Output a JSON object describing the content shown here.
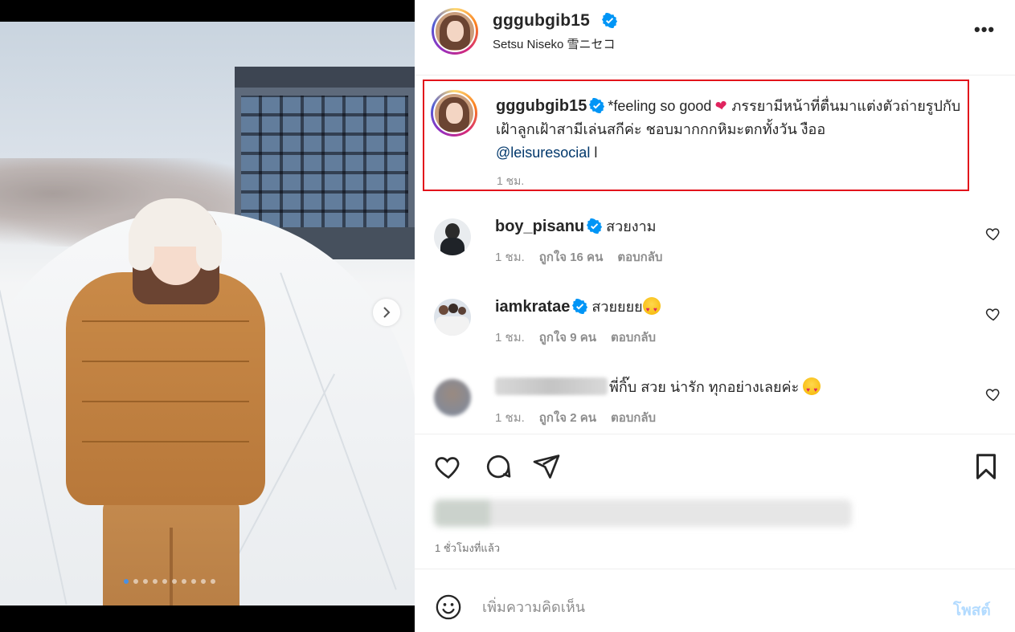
{
  "post": {
    "username": "gggubgib15",
    "location": "Setsu Niseko 雪ニセコ",
    "more_label": "•••"
  },
  "caption": {
    "username": "gggubgib15",
    "text_start": "*feeling so good ",
    "text_rest": " ภรรยามีหน้าที่ตื่นมาแต่งตัวถ่ายรูปกับเฝ้าลูกเฝ้าสามีเล่นสกีค่ะ ชอบมากกกหิมะตกทั้งวัน งืออ",
    "mention": "@leisuresocial",
    "text_end": " l",
    "time": "1 ชม."
  },
  "comments": [
    {
      "username": "boy_pisanu",
      "text": "สวยงาม",
      "time": "1 ชม.",
      "likes": "ถูกใจ 16 คน",
      "reply": "ตอบกลับ"
    },
    {
      "username": "iamkratae",
      "text": "สวยยยย",
      "time": "1 ชม.",
      "likes": "ถูกใจ 9 คน",
      "reply": "ตอบกลับ"
    },
    {
      "username": "",
      "text": "พี่กิ๊บ สวย น่ารัก ทุกอย่างเลยค่ะ ",
      "time": "1 ชม.",
      "likes": "ถูกใจ 2 คน",
      "reply": "ตอบกลับ"
    }
  ],
  "post_time": "1 ชั่วโมงที่แล้ว",
  "comment_bar": {
    "placeholder": "เพิ่มความคิดเห็น",
    "post_label": "โพสต์"
  },
  "carousel": {
    "dot_count": 10,
    "active_index": 0
  },
  "colors": {
    "verified": "#0095f6",
    "highlight_border": "#e2131b",
    "post_button": "#b3dbff"
  }
}
